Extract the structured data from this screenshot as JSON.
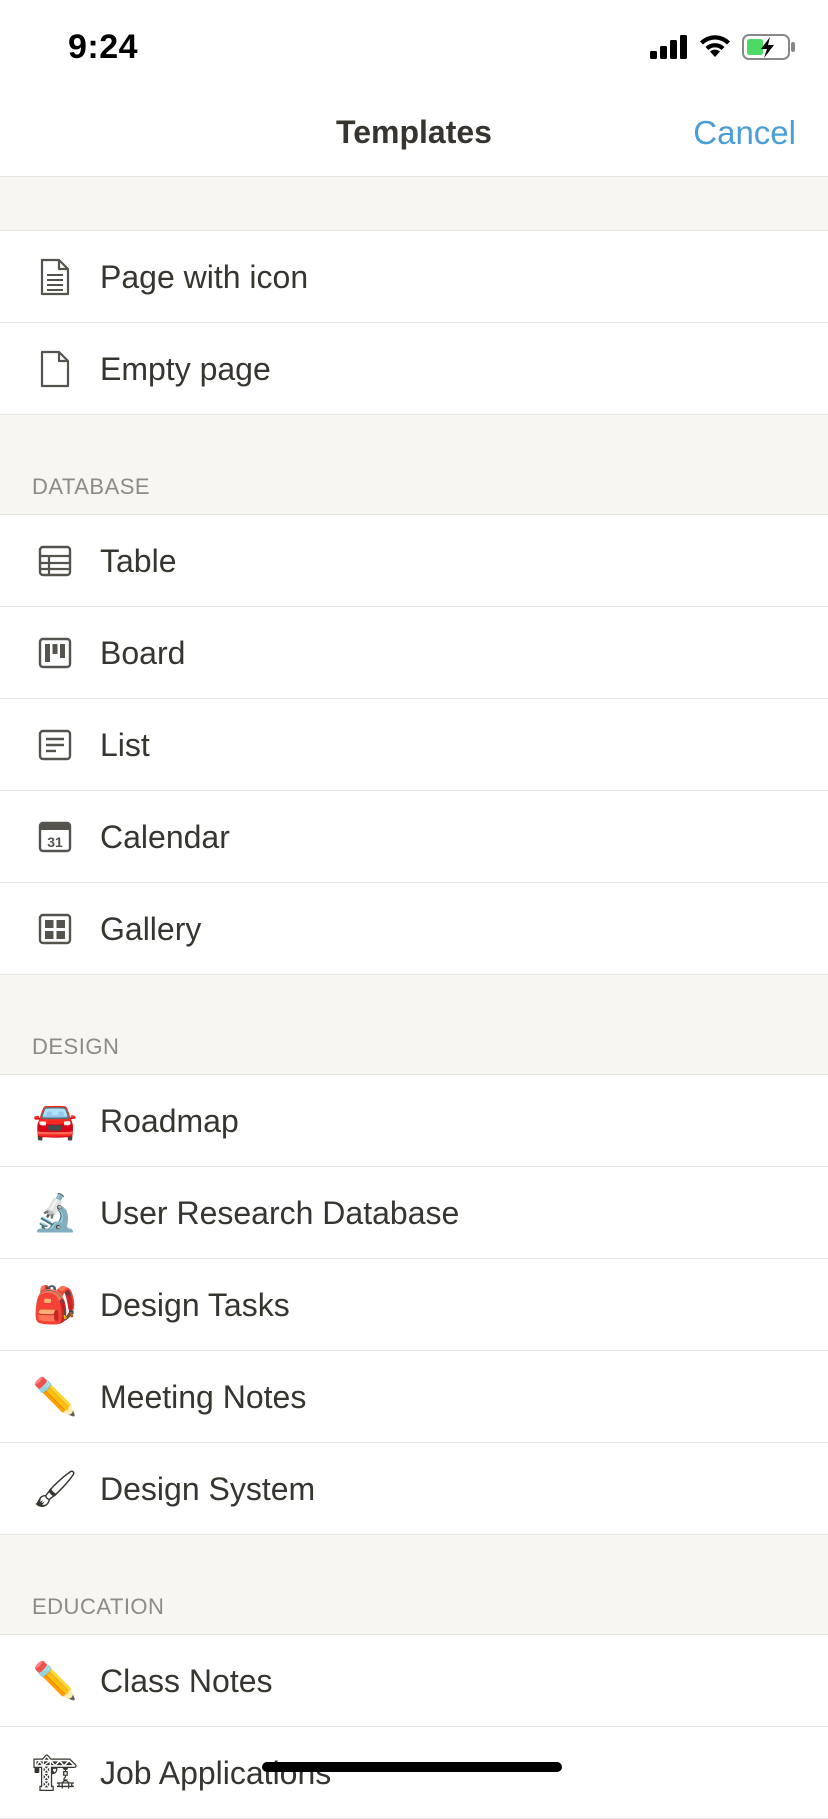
{
  "status_bar": {
    "time": "9:24",
    "icons": [
      "signal-icon",
      "wifi-icon",
      "battery-charging-icon"
    ]
  },
  "nav": {
    "title": "Templates",
    "cancel_label": "Cancel"
  },
  "colors": {
    "accent": "#4a9fd8",
    "section_bg": "#f7f6f3",
    "text": "#37352f",
    "muted": "#8c8b88"
  },
  "basic": {
    "items": [
      {
        "label": "Page with icon",
        "icon": "page-with-icon-icon"
      },
      {
        "label": "Empty page",
        "icon": "empty-page-icon"
      }
    ]
  },
  "database": {
    "header": "DATABASE",
    "items": [
      {
        "label": "Table",
        "icon": "table-icon"
      },
      {
        "label": "Board",
        "icon": "board-icon"
      },
      {
        "label": "List",
        "icon": "list-icon"
      },
      {
        "label": "Calendar",
        "icon": "calendar-icon",
        "icon_text": "31"
      },
      {
        "label": "Gallery",
        "icon": "gallery-icon"
      }
    ]
  },
  "design": {
    "header": "DESIGN",
    "items": [
      {
        "label": "Roadmap",
        "icon": "car-icon",
        "emoji": "🚘"
      },
      {
        "label": "User Research Database",
        "icon": "microscope-icon",
        "emoji": "🔬"
      },
      {
        "label": "Design Tasks",
        "icon": "backpack-icon",
        "emoji": "🎒"
      },
      {
        "label": "Meeting Notes",
        "icon": "pencil-icon",
        "emoji": "✏️"
      },
      {
        "label": "Design System",
        "icon": "paintbrush-icon",
        "emoji": "🖌"
      }
    ]
  },
  "education": {
    "header": "EDUCATION",
    "items": [
      {
        "label": "Class Notes",
        "icon": "pencil-icon",
        "emoji": "✏️"
      },
      {
        "label": "Job Applications",
        "icon": "crane-icon",
        "emoji": "🏗"
      }
    ]
  }
}
